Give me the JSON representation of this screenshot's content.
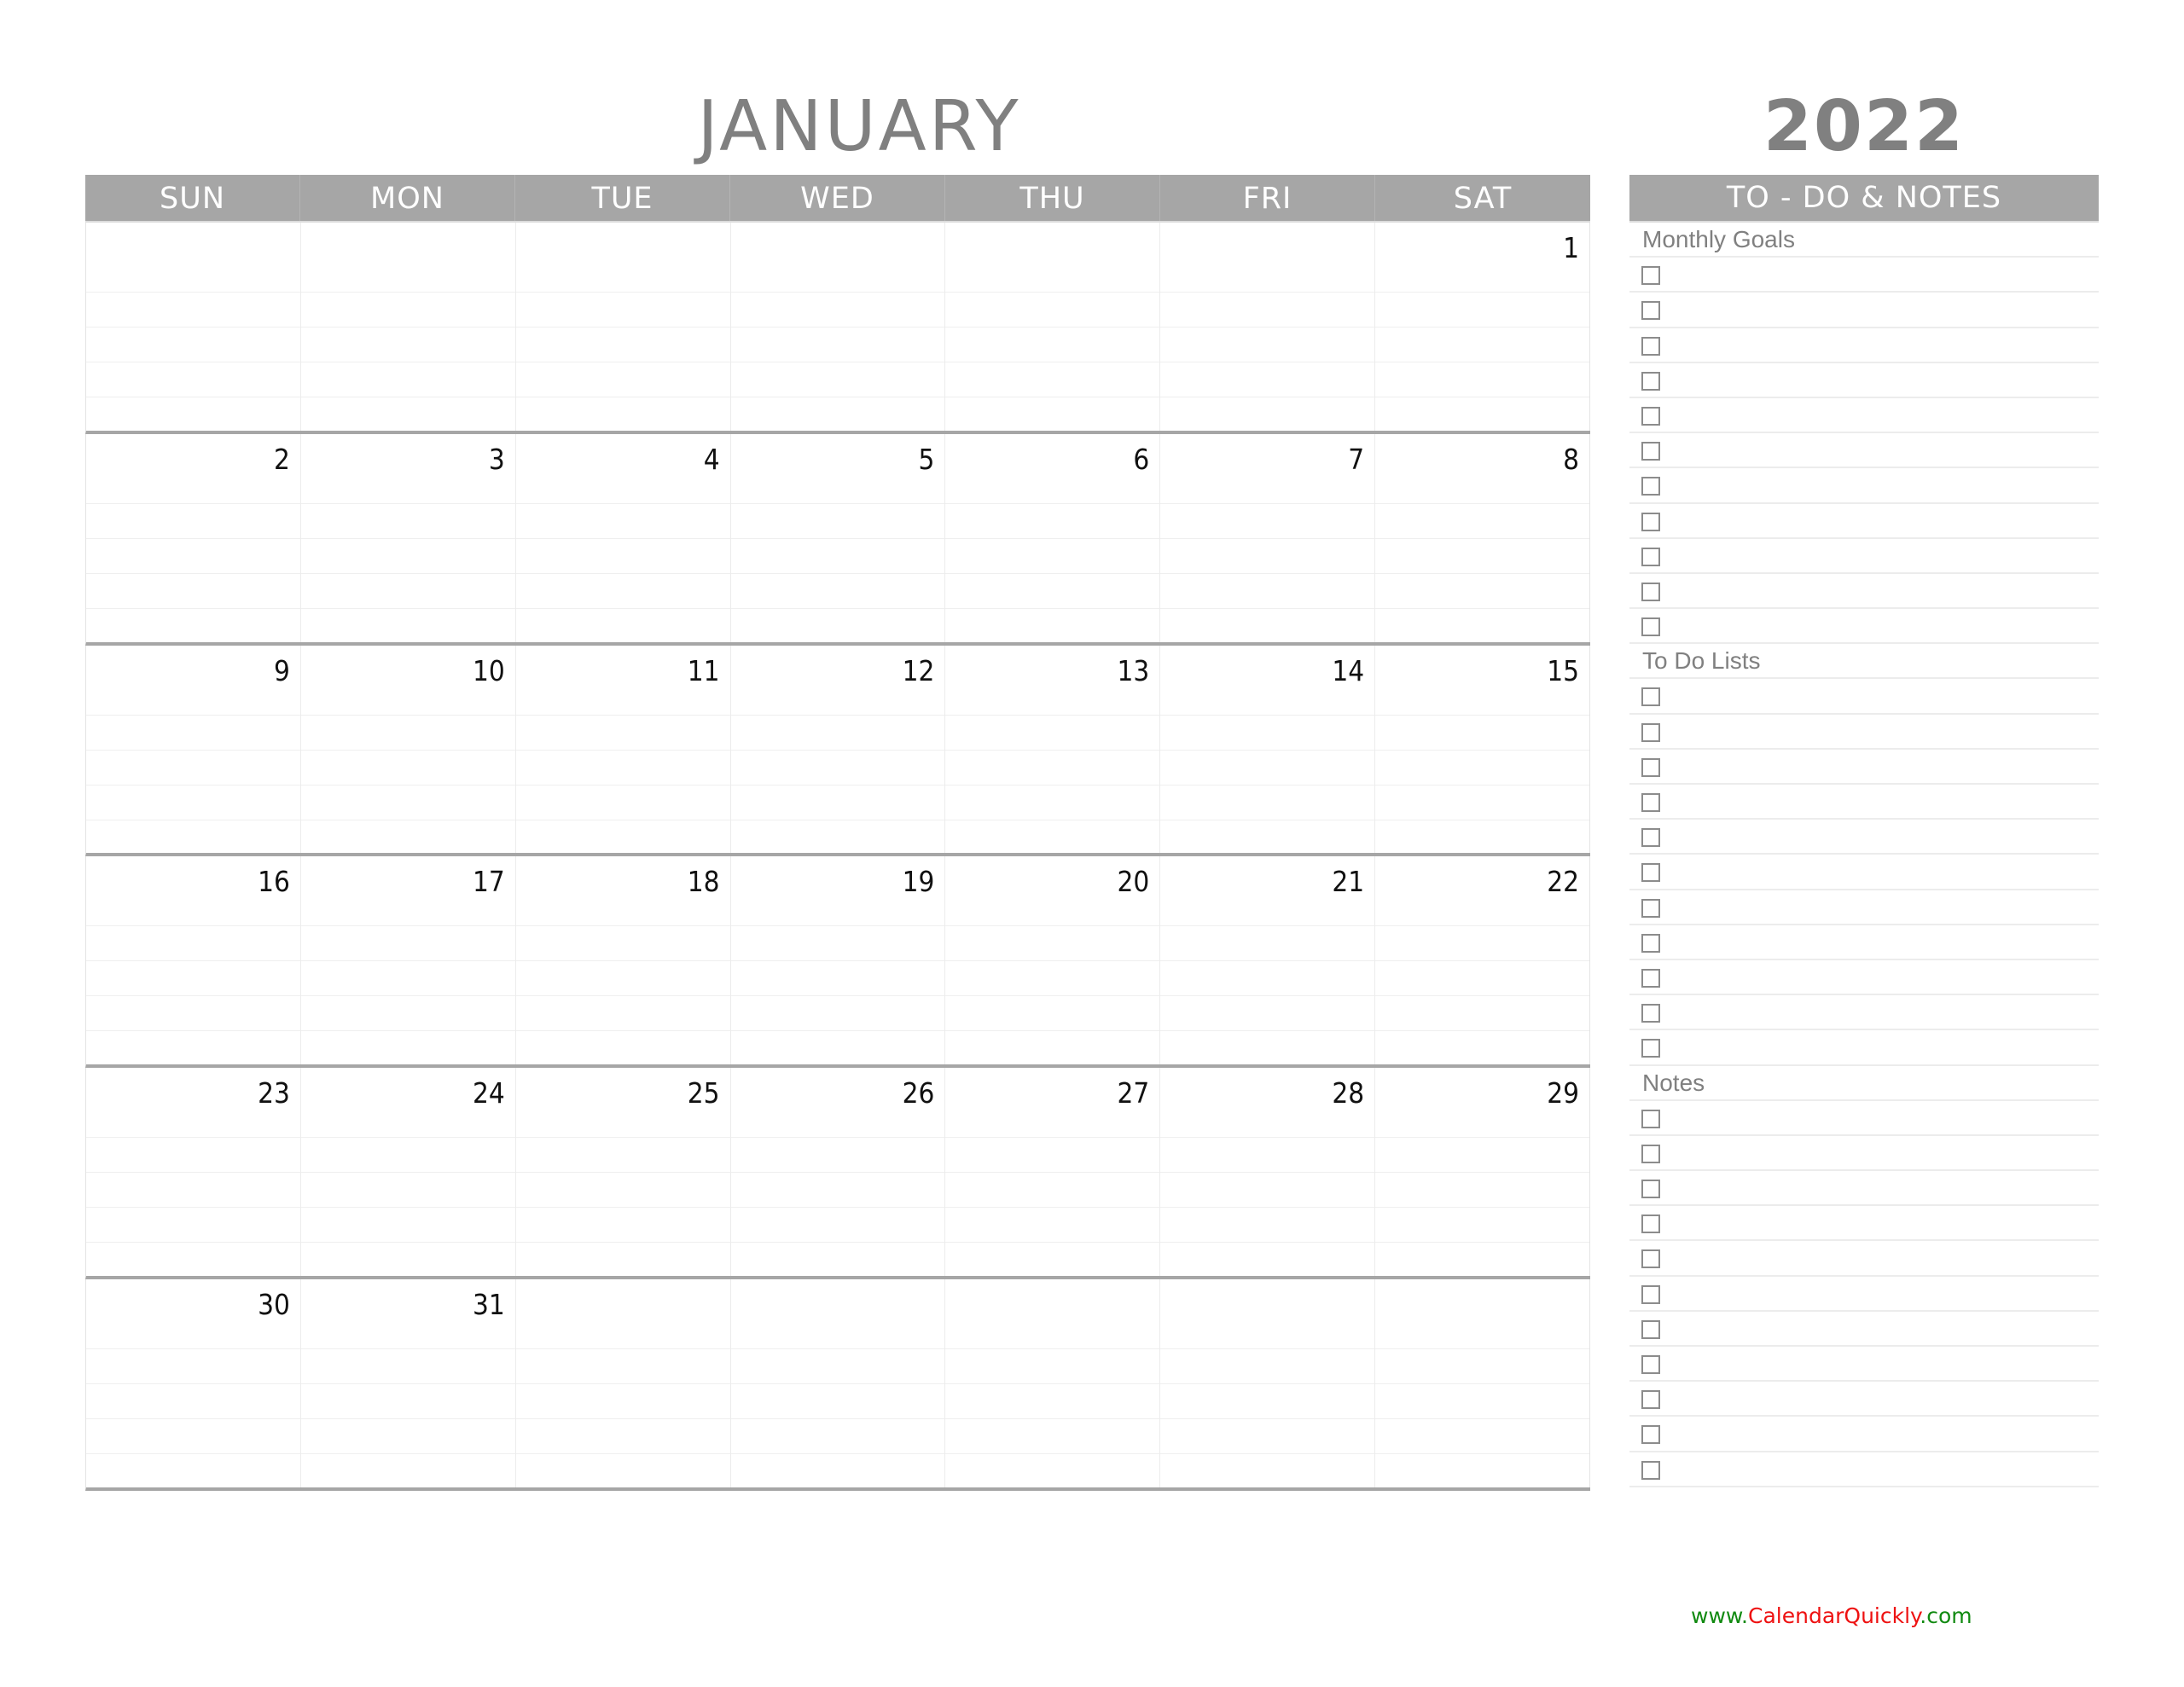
{
  "header": {
    "month": "JANUARY",
    "year": "2022"
  },
  "calendar": {
    "weekdays": [
      "SUN",
      "MON",
      "TUE",
      "WED",
      "THU",
      "FRI",
      "SAT"
    ],
    "weeks": [
      [
        "",
        "",
        "",
        "",
        "",
        "",
        "1"
      ],
      [
        "2",
        "3",
        "4",
        "5",
        "6",
        "7",
        "8"
      ],
      [
        "9",
        "10",
        "11",
        "12",
        "13",
        "14",
        "15"
      ],
      [
        "16",
        "17",
        "18",
        "19",
        "20",
        "21",
        "22"
      ],
      [
        "23",
        "24",
        "25",
        "26",
        "27",
        "28",
        "29"
      ],
      [
        "30",
        "31",
        "",
        "",
        "",
        "",
        ""
      ]
    ]
  },
  "todo_panel": {
    "title": "TO - DO & NOTES",
    "sections": [
      {
        "label": "Monthly Goals",
        "checkbox_count": 11
      },
      {
        "label": "To Do Lists",
        "checkbox_count": 11
      },
      {
        "label": "Notes",
        "checkbox_count": 11
      }
    ]
  },
  "footer": {
    "prefix": "www.",
    "brand": "CalendarQuickly",
    "suffix": ".com",
    "colors": {
      "prefix": "#118a11",
      "brand": "#ee1111",
      "suffix": "#118a11"
    }
  },
  "theme": {
    "header_band": "#a6a6a6",
    "title_text": "#808080",
    "week_separator": "#a6a6a6"
  }
}
